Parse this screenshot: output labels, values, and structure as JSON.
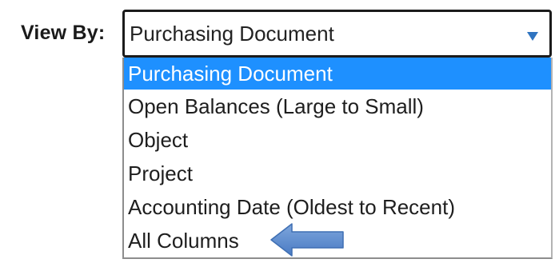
{
  "view_by": {
    "label": "View By:",
    "selected_value": "Purchasing Document",
    "arrow_icon": "caret-down-icon",
    "options": [
      {
        "label": "Purchasing Document",
        "highlighted": true
      },
      {
        "label": "Open Balances (Large to Small)",
        "highlighted": false
      },
      {
        "label": "Object",
        "highlighted": false
      },
      {
        "label": "Project",
        "highlighted": false
      },
      {
        "label": "Accounting Date (Oldest to Recent)",
        "highlighted": false
      },
      {
        "label": "All Columns",
        "highlighted": false
      }
    ]
  },
  "annotation": {
    "icon": "left-arrow-icon",
    "color": "#4f81bd"
  },
  "colors": {
    "highlight": "#1e90ff",
    "dropdown_arrow": "#2f74c0"
  }
}
